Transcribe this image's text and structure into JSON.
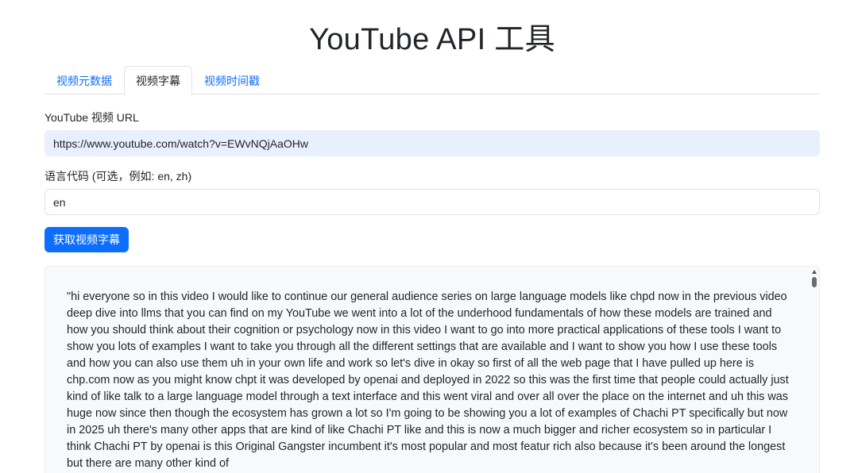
{
  "title": "YouTube API 工具",
  "tabs": [
    {
      "label": "视频元数据",
      "active": false
    },
    {
      "label": "视频字幕",
      "active": true
    },
    {
      "label": "视频时间戳",
      "active": false
    }
  ],
  "form": {
    "url_label": "YouTube 视频 URL",
    "url_value": "https://www.youtube.com/watch?v=EWvNQjAaOHw",
    "lang_label": "语言代码 (可选，例如: en, zh)",
    "lang_value": "en",
    "submit_label": "获取视频字幕"
  },
  "result": {
    "text": "\"hi everyone so in this video I would like to continue our general audience series on large language models like chpd now in the previous video deep dive into llms that you can find on my YouTube we went into a lot of the underhood fundamentals of how these models are trained and how you should think about their cognition or psychology now in this video I want to go into more practical applications of these tools I want to show you lots of examples I want to take you through all the different settings that are available and I want to show you how I use these tools and how you can also use them uh in your own life and work so let's dive in okay so first of all the web page that I have pulled up here is chp.com now as you might know chpt it was developed by openai and deployed in 2022 so this was the first time that people could actually just kind of like talk to a large language model through a text interface and this went viral and over all over the place on the internet and uh this was huge now since then though the ecosystem has grown a lot so I'm going to be showing you a lot of examples of Chachi PT specifically but now in 2025 uh there's many other apps that are kind of like Chachi PT like and this is now a much bigger and richer ecosystem so in particular I think Chachi PT by openai is this Original Gangster incumbent it's most popular and most featur rich also because it's been around the longest but there are many other kind of"
  }
}
